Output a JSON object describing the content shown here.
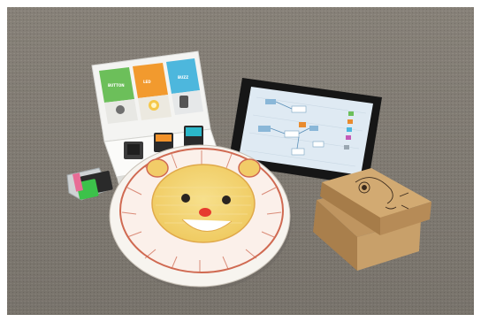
{
  "photo": {
    "description_free": true,
    "card_tiles": [
      {
        "label": "BUTTON",
        "color": "#6cbf5a"
      },
      {
        "label": "LED",
        "color": "#f29a2e"
      },
      {
        "label": "BUZZ",
        "color": "#4db7dd"
      }
    ],
    "colors": {
      "carpet": "#8b857c",
      "frame": "#ffffff",
      "box": "#c7a06a",
      "plate_stroke": "#d06a52",
      "lion_face": "#f3d37a"
    }
  }
}
